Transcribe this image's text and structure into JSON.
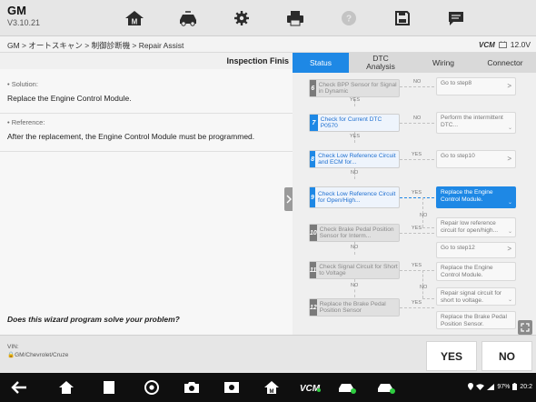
{
  "app": {
    "brand": "GM",
    "version": "V3.10.21"
  },
  "toolbar": {
    "icons": [
      "home-icon",
      "vehicle-icon",
      "settings-icon",
      "print-icon",
      "help-icon",
      "save-icon",
      "message-icon"
    ]
  },
  "breadcrumb": {
    "path": "GM > オートスキャン > 制御診断機 > Repair Assist",
    "vci_label": "VCM",
    "battery_voltage": "12.0V"
  },
  "left_panel": {
    "header_title": "Inspection Finis",
    "solution_label": "• Solution:",
    "solution_text": "Replace the Engine Control Module.",
    "reference_label": "• Reference:",
    "reference_text": "After the replacement, the Engine Control Module must be programmed.",
    "question": "Does this wizard program solve your problem?"
  },
  "tabs": [
    {
      "label": "Status",
      "active": true
    },
    {
      "label": "DTC Analysis",
      "active": false
    },
    {
      "label": "Wiring",
      "active": false
    },
    {
      "label": "Connector",
      "active": false
    }
  ],
  "flow": {
    "steps": [
      {
        "num": "6",
        "text": "Check BPP Sensor for Signal in Dynamic",
        "lit": false
      },
      {
        "num": "7",
        "text": "Check for Current DTC P0570",
        "lit": true
      },
      {
        "num": "8",
        "text": "Check Low Reference Circuit and ECM for...",
        "lit": true
      },
      {
        "num": "9",
        "text": "Check Low Reference Circuit for Open/High...",
        "lit": true
      },
      {
        "num": "10",
        "text": "Check Brake Pedal Position Sensor for Interm...",
        "lit": false
      },
      {
        "num": "11",
        "text": "Check Signal Circuit for Short to Voltage",
        "lit": false
      },
      {
        "num": "12",
        "text": "Replace the Brake Pedal Position Sensor",
        "lit": false
      }
    ],
    "results": [
      {
        "text": "Go to step8",
        "chevron": true,
        "highlight": false
      },
      {
        "text": "Perform the intermittent DTC...",
        "chevron": false,
        "highlight": false
      },
      {
        "text": "Go to step10",
        "chevron": true,
        "highlight": false
      },
      {
        "text": "Replace the Engine Control Module.",
        "chevron": false,
        "highlight": true
      },
      {
        "text": "Repair low reference circuit for open/high...",
        "chevron": false,
        "highlight": false
      },
      {
        "text": "Go to step12",
        "chevron": true,
        "highlight": false
      },
      {
        "text": "Replace the Engine Control Module.",
        "chevron": false,
        "highlight": false
      },
      {
        "text": "Repair signal circuit for short to voltage.",
        "chevron": false,
        "highlight": false
      },
      {
        "text": "Replace the Brake Pedal Position Sensor.",
        "chevron": false,
        "highlight": false
      }
    ],
    "yes_label": "YES",
    "no_label": "NO",
    "chevron": ">",
    "mini_mark": "⌄"
  },
  "footer": {
    "vin_label": "VIN:",
    "vehicle_path": "🔒GM/Chevrolet/Cruze",
    "yes_button": "YES",
    "no_button": "NO"
  },
  "status_bar": {
    "battery_percent": "97%",
    "time": "20:2"
  },
  "colors": {
    "accent": "#1e88e5",
    "topbar": "#e6e6e6",
    "navbar": "#0f0f0f"
  }
}
